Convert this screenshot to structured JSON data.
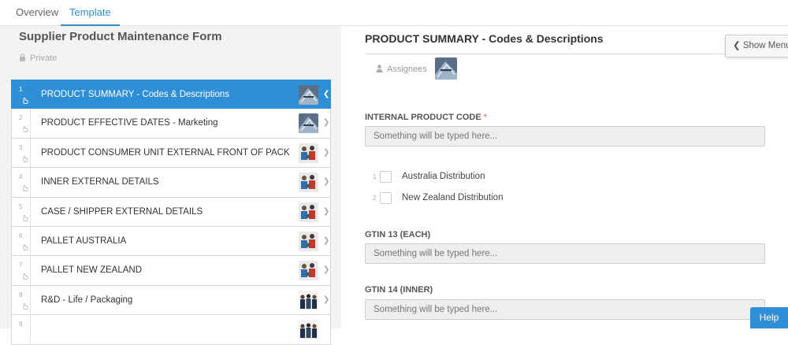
{
  "tabs": [
    {
      "label": "Overview",
      "active": false
    },
    {
      "label": "Template",
      "active": true
    }
  ],
  "left": {
    "form_title": "Supplier Product Maintenance Form",
    "privacy": "Private",
    "tasks": [
      {
        "num": "1",
        "label": "PRODUCT SUMMARY - Codes & Descriptions",
        "active": true,
        "thumb": "warehouse-photo"
      },
      {
        "num": "2",
        "label": "PRODUCT EFFECTIVE DATES - Marketing",
        "active": false,
        "thumb": "warehouse-photo"
      },
      {
        "num": "3",
        "label": "PRODUCT CONSUMER UNIT EXTERNAL FRONT OF PACK",
        "active": false,
        "thumb": "team-photo"
      },
      {
        "num": "4",
        "label": "INNER EXTERNAL DETAILS",
        "active": false,
        "thumb": "team-photo"
      },
      {
        "num": "5",
        "label": "CASE / SHIPPER EXTERNAL DETAILS",
        "active": false,
        "thumb": "team-photo"
      },
      {
        "num": "6",
        "label": "PALLET AUSTRALIA",
        "active": false,
        "thumb": "team-photo"
      },
      {
        "num": "7",
        "label": "PALLET NEW ZEALAND",
        "active": false,
        "thumb": "team-photo"
      },
      {
        "num": "8",
        "label": "R&D - Life / Packaging",
        "active": false,
        "thumb": "people-photo"
      },
      {
        "num": "9",
        "label": "",
        "active": false,
        "thumb": "people-photo"
      }
    ]
  },
  "right": {
    "title": "PRODUCT SUMMARY - Codes & Descriptions",
    "assignees_label": "Assignees",
    "show_menu_label": "Show Menu",
    "fields": [
      {
        "label": "INTERNAL PRODUCT CODE",
        "required": "*",
        "placeholder": "Something will be typed here..."
      },
      {
        "label": "GTIN 13 (EACH)",
        "placeholder": "Something will be typed here..."
      },
      {
        "label": "GTIN 14 (INNER)",
        "placeholder": "Something will be typed here..."
      }
    ],
    "checkboxes": [
      {
        "num": "1",
        "label": "Australia Distribution"
      },
      {
        "num": "2",
        "label": "New Zealand Distribution"
      }
    ]
  },
  "help_label": "Help",
  "colors": {
    "accent": "#2f8fd6",
    "required": "#e05a5a",
    "input_bg": "#eeeeee",
    "left_bg": "#f3f3f3"
  }
}
